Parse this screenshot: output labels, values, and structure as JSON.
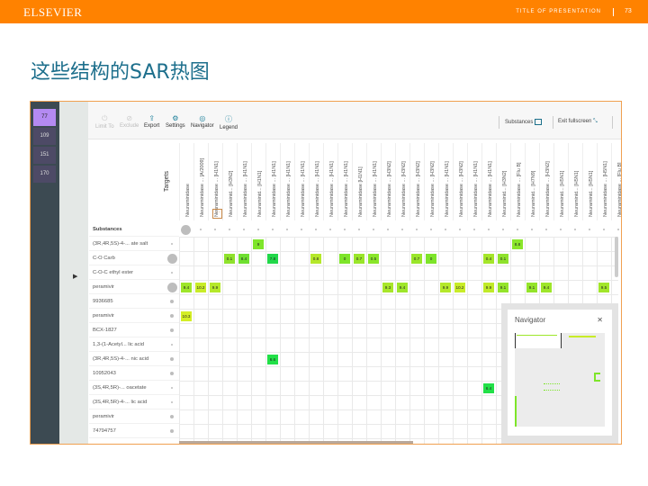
{
  "header": {
    "logo": "ELSEVIER",
    "presentation_title": "TITLE OF PRESENTATION",
    "page_number": "73"
  },
  "slide_title": "这些结构的SAR热图",
  "sidebar": {
    "tiles": [
      {
        "label": "77",
        "active": true
      },
      {
        "label": "109"
      },
      {
        "label": "151"
      },
      {
        "label": "170"
      }
    ]
  },
  "toolbar": {
    "buttons": [
      {
        "icon": "limit-icon",
        "label": "Limit To",
        "disabled": true
      },
      {
        "icon": "exclude-icon",
        "label": "Exclude",
        "disabled": true
      },
      {
        "icon": "export-icon",
        "label": "Export"
      },
      {
        "icon": "settings-icon",
        "label": "Settings"
      },
      {
        "icon": "navigator-icon",
        "label": "Navigator"
      },
      {
        "icon": "legend-icon",
        "label": "Legend"
      }
    ],
    "substances_label": "Substances",
    "exit_fullscreen_label": "Exit fullscreen"
  },
  "grid": {
    "targets_label": "Targets",
    "substances_header": "Substances",
    "columns": [
      "Neuraminidase",
      "Neuraminidase ... [A/2009]",
      "Neuraminidase ... [H1N1]",
      "Neuraminid... [H3N2]",
      "Neuraminidase ... [H1N1]",
      "Neuraminid... [H1N1]",
      "Neuraminidase ... [H1N1]",
      "Neuraminidase ... [H1N1]",
      "Neuraminidase ... [H1N1]",
      "Neuraminidase ... [H1N1]",
      "Neuraminidase ... [H1N1]",
      "Neuraminidase ... [H1N1]",
      "Neuraminidase [H1N1]",
      "Neuraminidase ... [H1N1]",
      "Neuraminidase ... [H3N2]",
      "Neuraminidase ... [H3N2]",
      "Neuraminidase ... [H3N2]",
      "Neuraminidase ... [H3N2]",
      "Neuraminidase ... [H1N1]",
      "Neuraminidase ... [H3N2]",
      "Neuraminidase ... [H1N1]",
      "Neuraminidase ... [H1N1]",
      "Neuraminid... [H3N2]",
      "Neuraminidase ... [Flu B]",
      "Neuraminid... [H7N9]",
      "Neuraminidase ... [H3N2]",
      "Neuraminid... [H5N1]",
      "Neuraminid... [H5N1]",
      "Neuraminid... [H5N1]",
      "Neuraminidase ... [H5N1]",
      "Neuraminidase ... [Flu B]"
    ],
    "rows": [
      {
        "label": "(3R,4R,5S)-4-... ate salt",
        "ind": "dot"
      },
      {
        "label": "C-O Carb",
        "ind": "big"
      },
      {
        "label": "C-O-C ethyl ester",
        "ind": "dot"
      },
      {
        "label": "peramivir",
        "ind": "big"
      },
      {
        "label": "9936685",
        "ind": "small"
      },
      {
        "label": "peramivir",
        "ind": "small"
      },
      {
        "label": "BCX-1827",
        "ind": "small"
      },
      {
        "label": "1,3-(1-Acetyl... lic acid",
        "ind": "dot"
      },
      {
        "label": "(3R,4R,5S)-4-... nic acid",
        "ind": "small"
      },
      {
        "label": "10952043",
        "ind": "small"
      },
      {
        "label": "(3S,4R,5R)-... oacetate",
        "ind": "dot"
      },
      {
        "label": "(3S,4R,5R)-4-... lic acid",
        "ind": "dot"
      },
      {
        "label": "peramivir",
        "ind": "small"
      },
      {
        "label": "74794757",
        "ind": "small"
      }
    ],
    "cells": [
      {
        "r": 0,
        "c": 5,
        "v": "9",
        "color": "#7ee52a"
      },
      {
        "r": 0,
        "c": 23,
        "v": "8.8",
        "color": "#8ae62a"
      },
      {
        "r": 1,
        "c": 3,
        "v": "0.1",
        "color": "#8fe22c"
      },
      {
        "r": 1,
        "c": 4,
        "v": "8.4",
        "color": "#6fe030"
      },
      {
        "r": 1,
        "c": 6,
        "v": "7.8",
        "color": "#22d84a"
      },
      {
        "r": 1,
        "c": 9,
        "v": "0.8",
        "color": "#b5e82a"
      },
      {
        "r": 1,
        "c": 11,
        "v": "0",
        "color": "#7ee52a"
      },
      {
        "r": 1,
        "c": 12,
        "v": "0.7",
        "color": "#9ae62a"
      },
      {
        "r": 1,
        "c": 13,
        "v": "0.5",
        "color": "#8ae62a"
      },
      {
        "r": 1,
        "c": 16,
        "v": "0.7",
        "color": "#9ae62a"
      },
      {
        "r": 1,
        "c": 17,
        "v": "0",
        "color": "#7ee52a"
      },
      {
        "r": 1,
        "c": 21,
        "v": "0.4",
        "color": "#a5e62a"
      },
      {
        "r": 1,
        "c": 22,
        "v": "0.1",
        "color": "#8fe22c"
      },
      {
        "r": 3,
        "c": 0,
        "v": "9.4",
        "color": "#9ee62a"
      },
      {
        "r": 3,
        "c": 1,
        "v": "10.2",
        "color": "#c8ec28"
      },
      {
        "r": 3,
        "c": 2,
        "v": "9.9",
        "color": "#b5e82a"
      },
      {
        "r": 3,
        "c": 14,
        "v": "9.3",
        "color": "#a8e62a"
      },
      {
        "r": 3,
        "c": 15,
        "v": "9.4",
        "color": "#9ee62a"
      },
      {
        "r": 3,
        "c": 18,
        "v": "9.9",
        "color": "#b5e82a"
      },
      {
        "r": 3,
        "c": 19,
        "v": "10.2",
        "color": "#c8ec28"
      },
      {
        "r": 3,
        "c": 21,
        "v": "9.9",
        "color": "#c0ea28"
      },
      {
        "r": 3,
        "c": 22,
        "v": "9.1",
        "color": "#94e42a"
      },
      {
        "r": 3,
        "c": 24,
        "v": "9.1",
        "color": "#94e42a"
      },
      {
        "r": 3,
        "c": 25,
        "v": "9.4",
        "color": "#9ee62a"
      },
      {
        "r": 3,
        "c": 29,
        "v": "9.5",
        "color": "#a2e62a"
      },
      {
        "r": 5,
        "c": 0,
        "v": "10.3",
        "color": "#d4ee26"
      },
      {
        "r": 8,
        "c": 6,
        "v": "6.6",
        "color": "#22e048"
      },
      {
        "r": 10,
        "c": 21,
        "v": "6.4",
        "color": "#22e048"
      }
    ]
  },
  "navigator": {
    "title": "Navigator",
    "close_icon": "close-icon"
  }
}
